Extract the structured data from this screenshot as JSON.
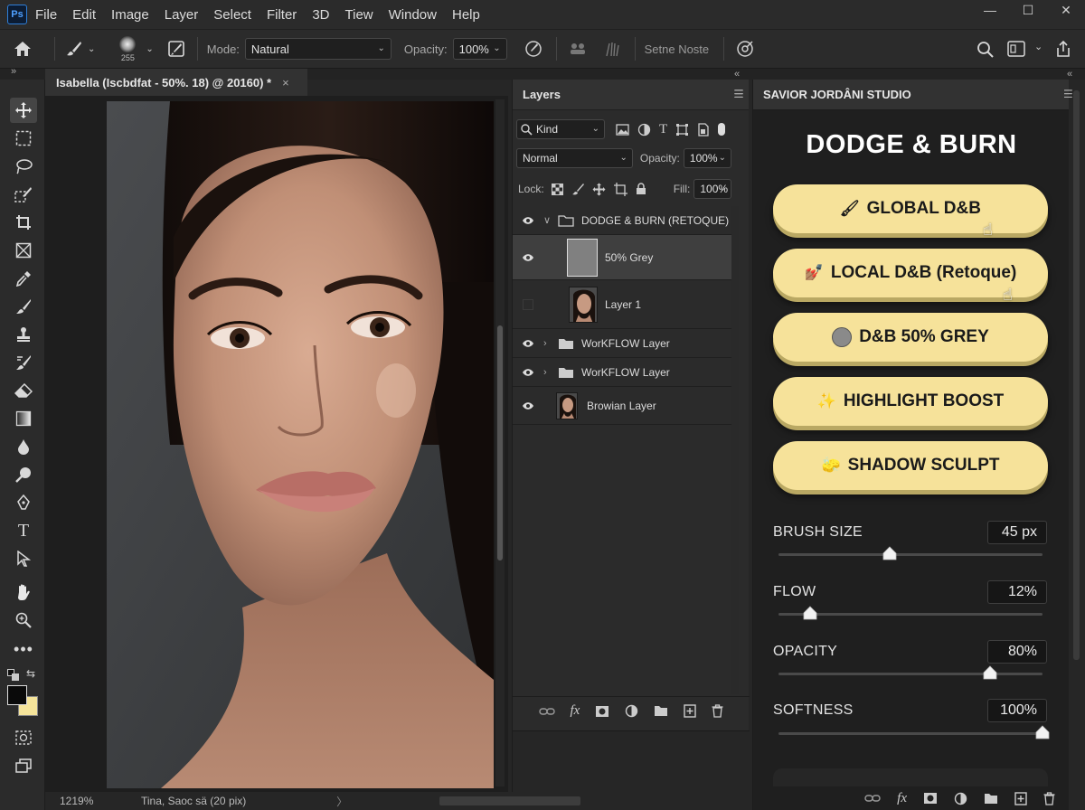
{
  "app": {
    "logo": "Ps"
  },
  "menu": [
    "File",
    "Edit",
    "Image",
    "Layer",
    "Select",
    "Filter",
    "3D",
    "Tiew",
    "Window",
    "Help"
  ],
  "window_controls": [
    "—",
    "☐",
    "✕"
  ],
  "options_bar": {
    "brush_size": "255",
    "mode_label": "Mode:",
    "mode_value": "Natural",
    "opacity_label": "Opacity:",
    "opacity_value": "100%",
    "extra_label": "Setne Noste"
  },
  "document": {
    "tab_title": "Isabella (Iscbdfat - 50%. 18) @ 20160) *",
    "close": "×"
  },
  "status_bar": {
    "zoom": "1219%",
    "info": "Tina, Saoc sä (20 pix)",
    "chevron": "〉"
  },
  "layers_panel": {
    "title": "Layers",
    "kind_filter": "Kind",
    "blend_mode": "Normal",
    "opacity_label": "Opacity:",
    "opacity_value": "100%",
    "lock_label": "Lock:",
    "fill_label": "Fill:",
    "fill_value": "100%",
    "layers": [
      {
        "name": "DODGE & BURN (RETOQUE)",
        "type": "group",
        "visible": true,
        "expanded": true
      },
      {
        "name": "50% Grey",
        "type": "grey",
        "visible": true,
        "selected": true
      },
      {
        "name": "Layer 1",
        "type": "portrait",
        "visible": false
      },
      {
        "name": "WorKFLOW Layer",
        "type": "group",
        "visible": true
      },
      {
        "name": "WorKFLOW Layer",
        "type": "group",
        "visible": true
      },
      {
        "name": "Browian Layer",
        "type": "portrait",
        "visible": true
      }
    ]
  },
  "studio_panel": {
    "tab": "SAVIOR JORDÂNI STUDIO",
    "title": "DODGE & BURN",
    "buttons": [
      {
        "label": "GLOBAL D&B",
        "icon": "🖌"
      },
      {
        "label": "LOCAL D&B (Retoque)",
        "icon": "💅🏽"
      },
      {
        "label": "D&B 50% GREY",
        "icon": "grey-circle"
      },
      {
        "label": "HIGHLIGHT BOOST",
        "icon": "✨"
      },
      {
        "label": "SHADOW SCULPT",
        "icon": "🧽"
      }
    ],
    "sliders": [
      {
        "label": "BRUSH SIZE",
        "value": "45 px",
        "level": 0.42
      },
      {
        "label": "FLOW",
        "value": "12%",
        "level": 0.12
      },
      {
        "label": "OPACITY",
        "value": "80%",
        "level": 0.8
      },
      {
        "label": "SOFTNESS",
        "value": "100%",
        "level": 1.0
      }
    ]
  },
  "colors": {
    "accent_button": "#f6e29a",
    "panel_bg": "#1f1f1f",
    "app_bg": "#2b2b2b"
  }
}
